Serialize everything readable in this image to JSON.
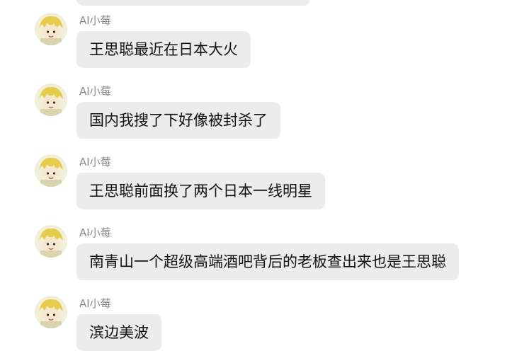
{
  "conversation": {
    "messages": [
      {
        "sender": "AI小莓",
        "text": "王思聪最近在日本大火"
      },
      {
        "sender": "AI小莓",
        "text": "国内我搜了下好像被封杀了"
      },
      {
        "sender": "AI小莓",
        "text": "王思聪前面换了两个日本一线明星"
      },
      {
        "sender": "AI小莓",
        "text": "南青山一个超级高端酒吧背后的老板查出来也是王思聪"
      },
      {
        "sender": "AI小莓",
        "text": "滨边美波"
      }
    ]
  },
  "colors": {
    "bubble_background": "#ececec",
    "sender_text": "#8a8a8a",
    "message_text": "#111111"
  },
  "icons": {
    "avatar": "cartoon-avatar-icon"
  }
}
